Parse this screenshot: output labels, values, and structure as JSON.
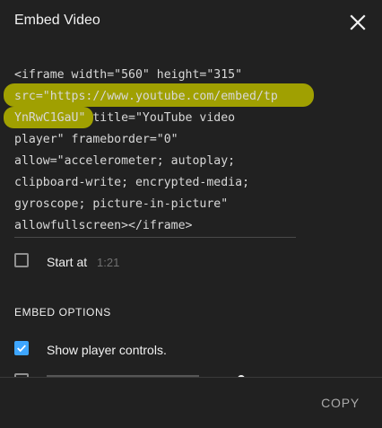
{
  "dialog": {
    "title": "Embed Video",
    "close_icon": "close-icon"
  },
  "embed_code": {
    "lines": [
      "<iframe width=\"560\" height=\"315\"",
      "src=\"https://www.youtube.com/embed/tp",
      "YnRwC1GaU\" title=\"YouTube video",
      "player\" frameborder=\"0\"",
      "allow=\"accelerometer; autoplay;",
      "clipboard-write; encrypted-media;",
      "gyroscope; picture-in-picture\"",
      "allowfullscreen></iframe>"
    ],
    "highlight_color": "#a8a800"
  },
  "start_at": {
    "label": "Start at",
    "time": "1:21",
    "checked": false
  },
  "embed_options": {
    "section_title": "EMBED OPTIONS",
    "options": [
      {
        "label": "Show player controls.",
        "checked": true
      }
    ]
  },
  "footer": {
    "copy_label": "COPY"
  },
  "colors": {
    "background": "#212121",
    "accent_blue": "#3ea6ff",
    "text_primary": "#f1f1f1",
    "text_muted": "#717171"
  }
}
